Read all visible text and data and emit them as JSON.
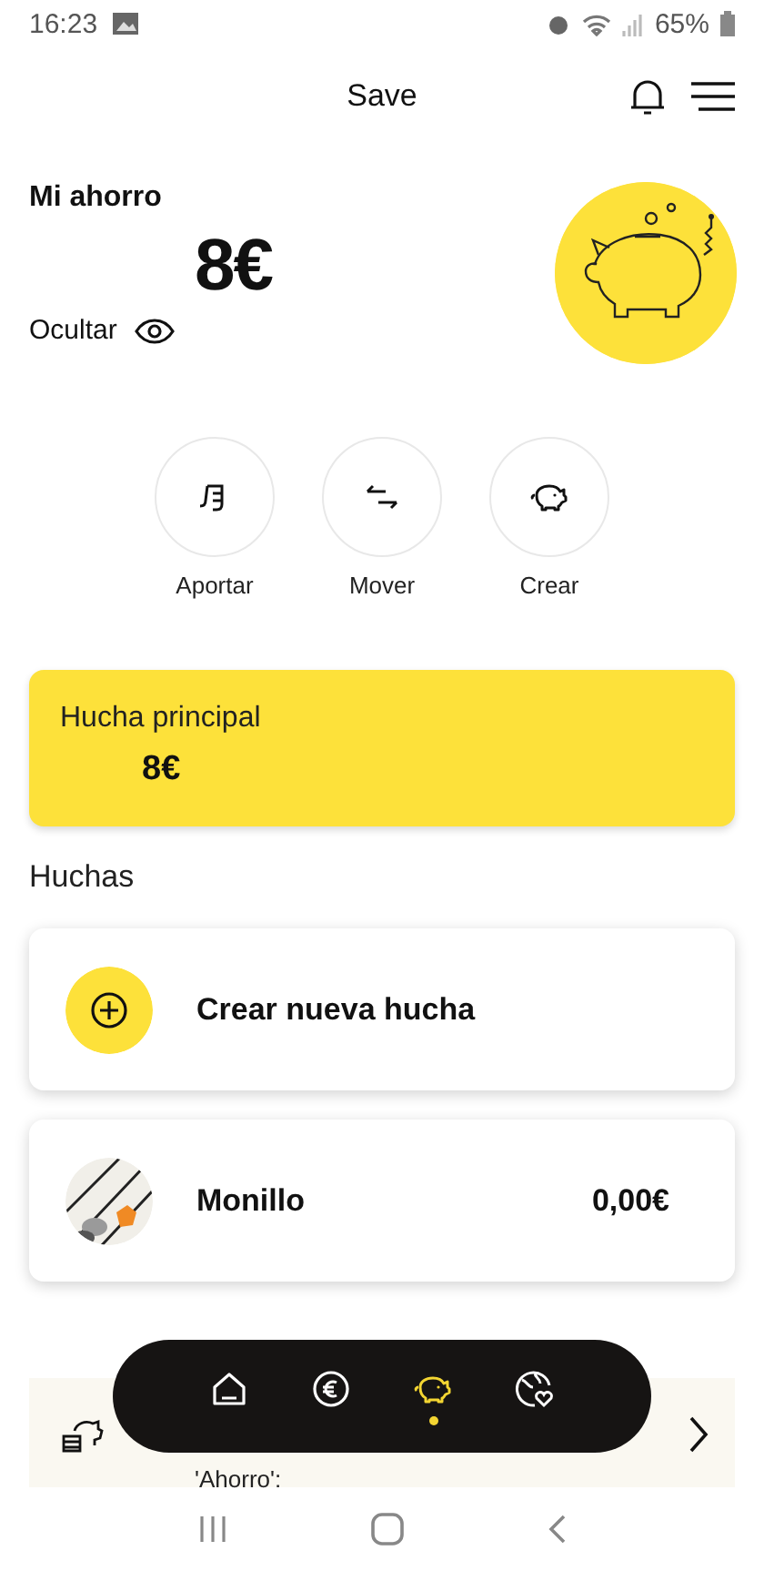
{
  "status_bar": {
    "time": "16:23",
    "battery": "65%"
  },
  "header": {
    "title": "Save"
  },
  "summary": {
    "label": "Mi ahorro",
    "amount": "8€",
    "hide_label": "Ocultar"
  },
  "actions": [
    {
      "label": "Aportar",
      "kind": "contribute"
    },
    {
      "label": "Mover",
      "kind": "move"
    },
    {
      "label": "Crear",
      "kind": "create"
    }
  ],
  "main_hucha": {
    "title": "Hucha principal",
    "amount": "8€"
  },
  "huchas_heading": "Huchas",
  "huchas": [
    {
      "kind": "create",
      "name": "Crear nueva hucha"
    },
    {
      "kind": "picture",
      "name": "Monillo",
      "amount": "0,00€"
    }
  ],
  "promo": {
    "text": "'Ahorro':"
  },
  "nav": [
    {
      "kind": "home",
      "selected": false
    },
    {
      "kind": "euro",
      "selected": false
    },
    {
      "kind": "piggy",
      "selected": true
    },
    {
      "kind": "globe",
      "selected": false
    }
  ]
}
